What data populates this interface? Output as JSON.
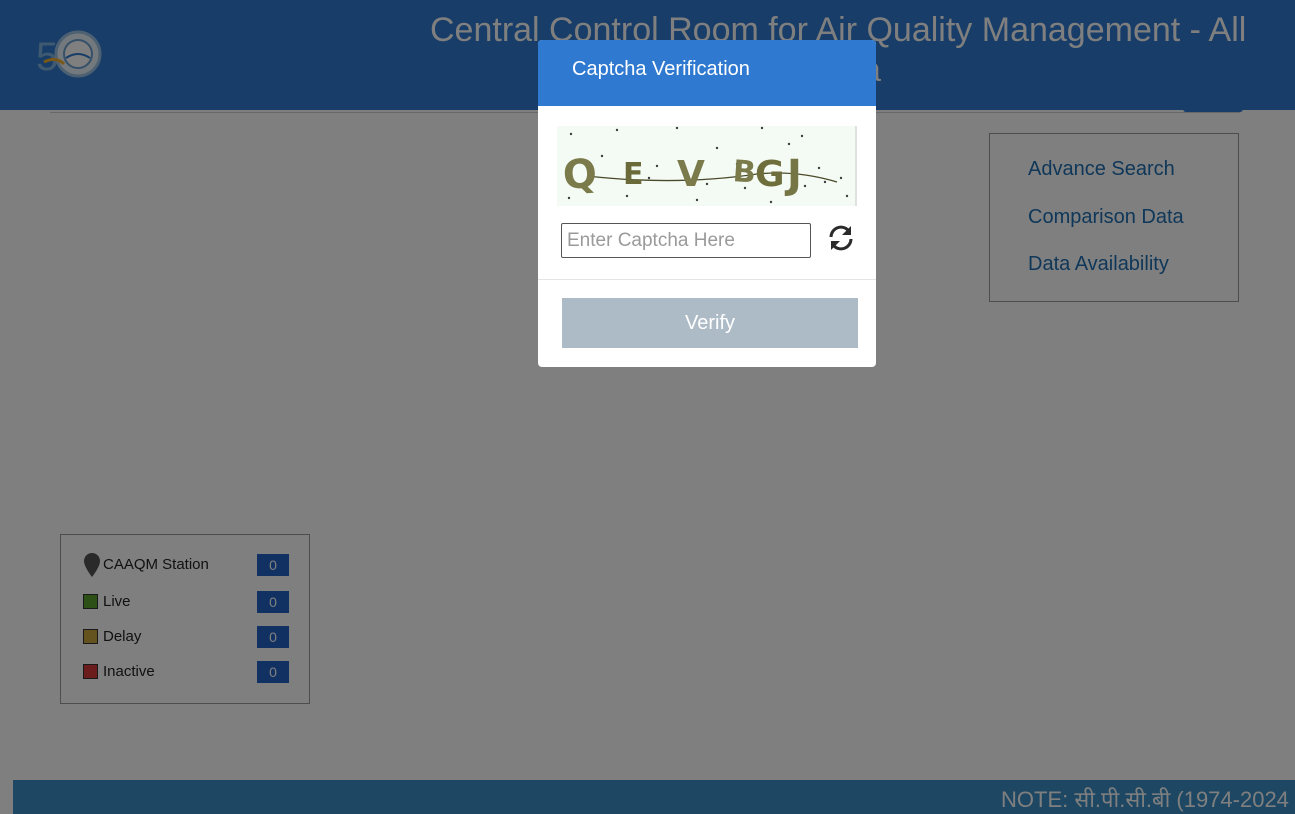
{
  "header": {
    "title_line1": "Central Control Room for Air Quality Management - All",
    "title_line2": "a"
  },
  "side_panel": {
    "links": [
      "Advance Search",
      "Comparison Data",
      "Data Availability"
    ]
  },
  "legend": {
    "items": [
      {
        "label": "CAAQM Station",
        "count": "0",
        "icon": "map-pin-icon"
      },
      {
        "label": "Live",
        "count": "0",
        "color": "#5aa02c"
      },
      {
        "label": "Delay",
        "count": "0",
        "color": "#c9a73c"
      },
      {
        "label": "Inactive",
        "count": "0",
        "color": "#d63b3b"
      }
    ]
  },
  "footer": {
    "note": "NOTE: सी.पी.सी.बी (1974-2024"
  },
  "modal": {
    "title": "Captcha Verification",
    "captcha_text": "QEVBGJ",
    "input_placeholder": "Enter Captcha Here",
    "verify_label": "Verify",
    "refresh_icon": "refresh-icon"
  },
  "colors": {
    "header_bg": "#2f7ad0",
    "legend_count_bg": "#2563c7",
    "verify_disabled_bg": "#adbbc7"
  }
}
